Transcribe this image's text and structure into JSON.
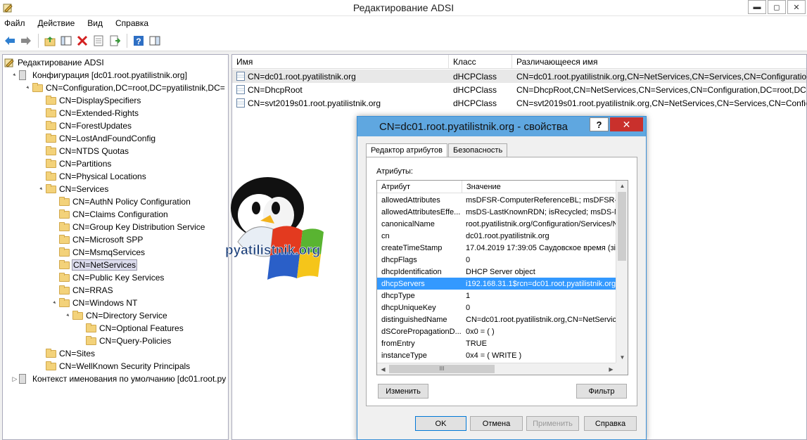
{
  "window": {
    "title": "Редактирование ADSI",
    "controls": {
      "minimize": "▬",
      "maximize": "◻",
      "close": "✕"
    }
  },
  "menu": [
    "Файл",
    "Действие",
    "Вид",
    "Справка"
  ],
  "toolbar": [
    "back-arrow-icon",
    "forward-arrow-icon",
    "folder-up-icon",
    "console-tree-icon",
    "delete-icon",
    "properties-icon",
    "export-icon",
    "help-icon",
    "view-icon"
  ],
  "tree": {
    "root": "Редактирование ADSI",
    "nodes": [
      {
        "label": "Конфигурация [dc01.root.pyatilistnik.org]",
        "kind": "server",
        "exp": "▲"
      },
      {
        "label": "CN=Configuration,DC=root,DC=pyatilistnik,DC=",
        "kind": "folder",
        "exp": "▲"
      },
      {
        "label": "CN=DisplaySpecifiers",
        "kind": "folder",
        "exp": ""
      },
      {
        "label": "CN=Extended-Rights",
        "kind": "folder",
        "exp": ""
      },
      {
        "label": "CN=ForestUpdates",
        "kind": "folder",
        "exp": ""
      },
      {
        "label": "CN=LostAndFoundConfig",
        "kind": "folder",
        "exp": ""
      },
      {
        "label": "CN=NTDS Quotas",
        "kind": "folder",
        "exp": ""
      },
      {
        "label": "CN=Partitions",
        "kind": "folder",
        "exp": ""
      },
      {
        "label": "CN=Physical Locations",
        "kind": "folder",
        "exp": ""
      },
      {
        "label": "CN=Services",
        "kind": "folder",
        "exp": "▲"
      },
      {
        "label": "CN=AuthN Policy Configuration",
        "kind": "folder",
        "exp": ""
      },
      {
        "label": "CN=Claims Configuration",
        "kind": "folder",
        "exp": ""
      },
      {
        "label": "CN=Group Key Distribution Service",
        "kind": "folder",
        "exp": ""
      },
      {
        "label": "CN=Microsoft SPP",
        "kind": "folder",
        "exp": ""
      },
      {
        "label": "CN=MsmqServices",
        "kind": "folder",
        "exp": ""
      },
      {
        "label": "CN=NetServices",
        "kind": "folder",
        "exp": "",
        "selected": true
      },
      {
        "label": "CN=Public Key Services",
        "kind": "folder",
        "exp": ""
      },
      {
        "label": "CN=RRAS",
        "kind": "folder",
        "exp": ""
      },
      {
        "label": "CN=Windows NT",
        "kind": "folder",
        "exp": "▲"
      },
      {
        "label": "CN=Directory Service",
        "kind": "folder",
        "exp": "▲"
      },
      {
        "label": "CN=Optional Features",
        "kind": "folder",
        "exp": ""
      },
      {
        "label": "CN=Query-Policies",
        "kind": "folder",
        "exp": ""
      },
      {
        "label": "CN=Sites",
        "kind": "folder",
        "exp": ""
      },
      {
        "label": "CN=WellKnown Security Principals",
        "kind": "folder",
        "exp": ""
      },
      {
        "label": "Контекст именования по умолчанию [dc01.root.py",
        "kind": "server",
        "exp": "▷"
      }
    ]
  },
  "list": {
    "columns": [
      "Имя",
      "Класс",
      "Различающееся имя"
    ],
    "rows": [
      {
        "name": "CN=dc01.root.pyatilistnik.org",
        "class": "dHCPClass",
        "dn": "CN=dc01.root.pyatilistnik.org,CN=NetServices,CN=Services,CN=Configuratio"
      },
      {
        "name": "CN=DhcpRoot",
        "class": "dHCPClass",
        "dn": "CN=DhcpRoot,CN=NetServices,CN=Services,CN=Configuration,DC=root,DC="
      },
      {
        "name": "CN=svt2019s01.root.pyatilistnik.org",
        "class": "dHCPClass",
        "dn": "CN=svt2019s01.root.pyatilistnik.org,CN=NetServices,CN=Services,CN=Config"
      }
    ]
  },
  "logo": {
    "text": "pyatilistnik.org"
  },
  "dialog": {
    "title": "CN=dc01.root.pyatilistnik.org - свойства",
    "help": "?",
    "close": "✕",
    "tabs": [
      "Редактор атрибутов",
      "Безопасность"
    ],
    "attrs_label": "Атрибуты:",
    "columns": [
      "Атрибут",
      "Значение"
    ],
    "rows": [
      {
        "attr": "allowedAttributes",
        "value": "msDFSR-ComputerReferenceBL; msDFSR-M"
      },
      {
        "attr": "allowedAttributesEffe...",
        "value": "msDS-LastKnownRDN; isRecycled; msDS-N"
      },
      {
        "attr": "canonicalName",
        "value": "root.pyatilistnik.org/Configuration/Services/N"
      },
      {
        "attr": "cn",
        "value": "dc01.root.pyatilistnik.org"
      },
      {
        "attr": "createTimeStamp",
        "value": "17.04.2019 17:39:05 Саудовское время (зі"
      },
      {
        "attr": "dhcpFlags",
        "value": "0"
      },
      {
        "attr": "dhcpIdentification",
        "value": "DHCP Server object"
      },
      {
        "attr": "dhcpServers",
        "value": "i192.168.31.1$rcn=dc01.root.pyatilistnik.org$",
        "selected": true
      },
      {
        "attr": "dhcpType",
        "value": "1"
      },
      {
        "attr": "dhcpUniqueKey",
        "value": "0"
      },
      {
        "attr": "distinguishedName",
        "value": "CN=dc01.root.pyatilistnik.org,CN=NetService"
      },
      {
        "attr": "dSCorePropagationD...",
        "value": "0x0 = ( )"
      },
      {
        "attr": "fromEntry",
        "value": "TRUE"
      },
      {
        "attr": "instanceType",
        "value": "0x4 = ( WRITE )"
      }
    ],
    "scroll": {
      "up": "▲",
      "down": "▼",
      "left": "◀",
      "right": "▶",
      "grip": "III"
    },
    "edit_button": "Изменить",
    "filter_button": "Фильтр",
    "ok": "OK",
    "cancel": "Отмена",
    "apply": "Применить",
    "help_button": "Справка"
  }
}
